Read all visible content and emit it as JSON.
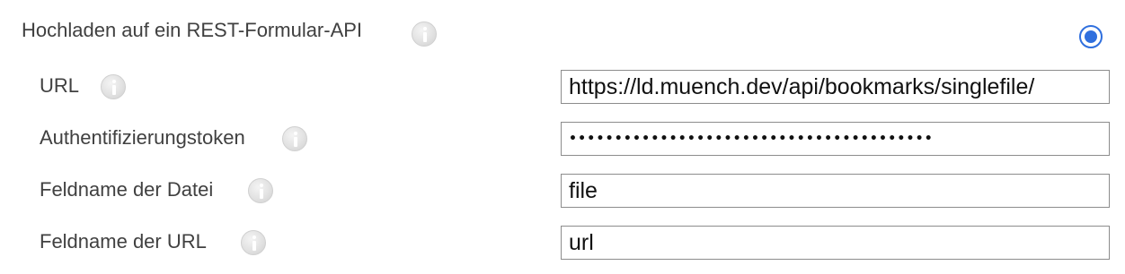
{
  "section": {
    "title": "Hochladen auf ein REST-Formular-API",
    "radio_selected": true
  },
  "fields": [
    {
      "label": "URL",
      "value": "https://ld.muench.dev/api/bookmarks/singlefile/",
      "type": "text"
    },
    {
      "label": "Authentifizierungstoken",
      "value": "••••••••••••••••••••••••••••••••••••••••",
      "type": "password"
    },
    {
      "label": "Feldname der Datei",
      "value": "file",
      "type": "text"
    },
    {
      "label": "Feldname der URL",
      "value": "url",
      "type": "text"
    }
  ],
  "icons": {
    "info": "info-icon",
    "radio": "radio-button-selected"
  },
  "colors": {
    "accent": "#2f6fde",
    "icon_gray": "#d6d6d6",
    "field_border": "#8c8c8c"
  }
}
